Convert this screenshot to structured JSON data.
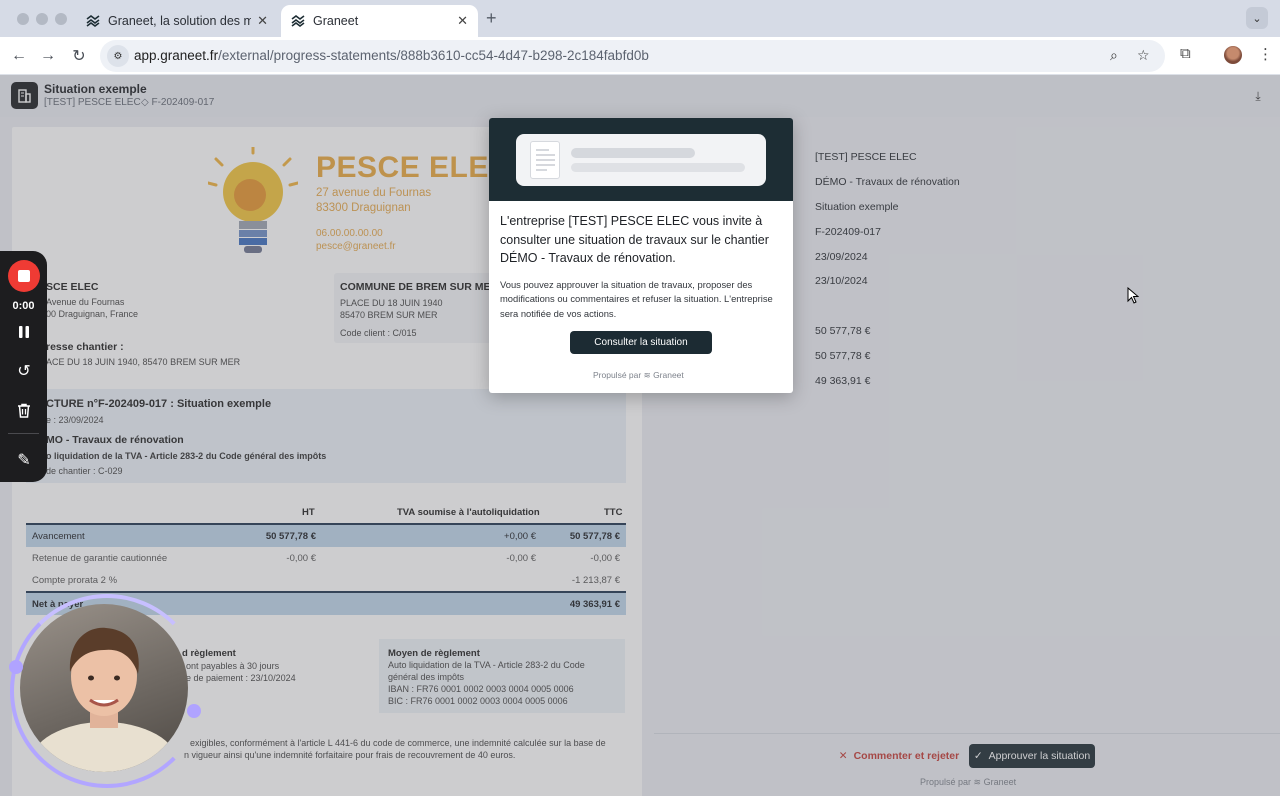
{
  "browser": {
    "tabs": [
      {
        "title": "Graneet, la solution des meilleurs",
        "active": false
      },
      {
        "title": "Graneet",
        "active": true
      }
    ],
    "url_domain": "app.graneet.fr",
    "url_path": "/external/progress-statements/888b3610-cc54-4d47-b298-2c184fabfd0b"
  },
  "header": {
    "title": "Situation exemple",
    "company": "[TEST] PESCE ELEC",
    "reference": "F-202409-017"
  },
  "document": {
    "brand_name": "PESCE ELEC",
    "brand_address_1": "27 avenue du Fournas",
    "brand_address_2": "83300 Draguignan",
    "brand_phone": "06.00.00.00.00",
    "brand_email": "pesce@graneet.fr",
    "sender_name": "SCE ELEC",
    "sender_line_1": "Avenue du Fournas",
    "sender_line_2": "00 Draguignan, France",
    "client_name": "COMMUNE DE BREM SUR MER",
    "client_line_1": "PLACE DU 18 JUIN 1940",
    "client_line_2": "85470 BREM SUR MER",
    "client_code": "Code client : C/015",
    "site_label": "resse chantier :",
    "site_address": "ACE DU 18 JUIN 1940, 85470 BREM SUR MER",
    "invoice_title": "CTURE n°F-202409-017 : Situation exemple",
    "invoice_date": "e : 23/09/2024",
    "project_title": "MO - Travaux de rénovation",
    "vat_note": "o liquidation de la TVA - Article 283-2 du Code général des impôts",
    "project_code": "de chantier : C-029",
    "table_headers": {
      "ht": "HT",
      "tva": "TVA soumise à l'autoliquidation",
      "ttc": "TTC"
    },
    "rows": [
      {
        "label": "Avancement",
        "ht": "50 577,78 €",
        "tva": "+0,00 €",
        "ttc": "50 577,78 €",
        "highlight": true
      },
      {
        "label": "Retenue de garantie cautionnée",
        "ht": "-0,00 €",
        "tva": "-0,00 €",
        "ttc": "-0,00 €",
        "highlight": false
      },
      {
        "label": "Compte prorata 2 %",
        "ht": "",
        "tva": "",
        "ttc": "-1 213,87 €",
        "highlight": false
      },
      {
        "label": "Net à payer",
        "ht": "",
        "tva": "",
        "ttc": "49 363,91 €",
        "highlight": true
      }
    ],
    "payment_terms_title": "d règlement",
    "payment_terms_line_1": "ont payables à 30 jours",
    "payment_terms_line_2": "e de paiement : 23/10/2024",
    "payment_method_title": "Moyen de règlement",
    "payment_method_line_1": "Auto liquidation de la TVA - Article 283-2 du Code",
    "payment_method_line_2": "général des impôts",
    "iban": "IBAN : FR76 0001 0002 0003 0004 0005 0006",
    "bic": "BIC : FR76 0001 0002 0003 0004 0005 0006",
    "legal_1": "exigibles, conformément à l'article L 441-6 du code de commerce, une indemnité calculée sur la base de",
    "legal_2": "n vigueur ainsi qu'une indemnité forfaitaire pour frais de recouvrement de 40 euros."
  },
  "summary": {
    "values": [
      "[TEST] PESCE ELEC",
      "DÉMO - Travaux de rénovation",
      "Situation exemple",
      "F-202409-017",
      "23/09/2024",
      "23/10/2024",
      "50 577,78 €",
      "50 577,78 €",
      "49 363,91 €"
    ],
    "reject_label": "Commenter et rejeter",
    "approve_label": "Approuver la situation",
    "powered_label": "Propulsé par",
    "powered_brand": "Graneet"
  },
  "modal": {
    "heading": "L'entreprise [TEST] PESCE ELEC vous invite à consulter une situation de travaux sur le chantier DÉMO - Travaux de rénovation.",
    "body": "Vous pouvez approuver la situation de travaux, proposer des modifications ou commentaires et refuser la situation. L'entreprise sera notifiée de vos actions.",
    "cta": "Consulter la situation",
    "powered_label": "Propulsé par",
    "powered_brand": "Graneet"
  },
  "recorder": {
    "time": "0:00"
  }
}
